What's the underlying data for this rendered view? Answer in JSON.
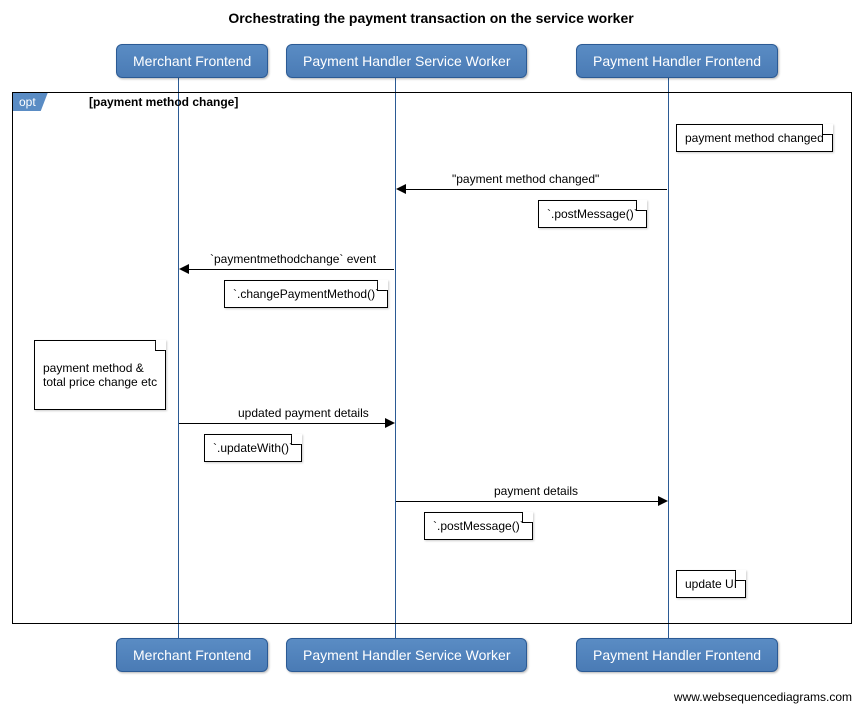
{
  "title": "Orchestrating the payment transaction on the service worker",
  "participants": {
    "merchant": "Merchant Frontend",
    "sw": "Payment Handler Service Worker",
    "frontend": "Payment Handler Frontend"
  },
  "opt": {
    "label": "opt",
    "guard": "[payment method change]"
  },
  "notes": {
    "pmchanged": "payment method changed",
    "postmsg1": "`.postMessage()`",
    "changepm": "`.changePaymentMethod()`",
    "merchantnote": "payment method &\ntotal price change etc",
    "updatewith": "`.updateWith()`",
    "postmsg2": "`.postMessage()`",
    "updateui": "update UI"
  },
  "messages": {
    "m1": "\"payment method changed\"",
    "m2": "`paymentmethodchange` event",
    "m3": "updated payment details",
    "m4": "payment details"
  },
  "watermark": "www.websequencediagrams.com"
}
